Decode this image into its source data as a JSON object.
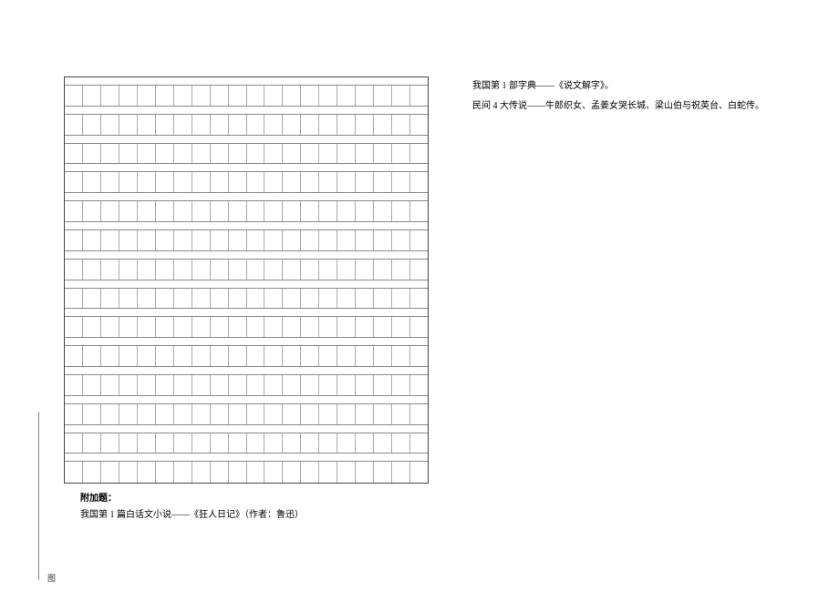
{
  "grid": {
    "columns": 20,
    "row_pairs": 14
  },
  "footer": {
    "heading": "附加题：",
    "line1": "我国第 1 篇白话文小说——《狂人日记》（作者：鲁迅）"
  },
  "right": {
    "line1": "我国第 1 部字典——《说文解字》。",
    "line2": "民间 4 大传说——牛郎织女、孟姜女哭长城、梁山伯与祝英台、白蛇传。"
  },
  "page_mark": "图"
}
